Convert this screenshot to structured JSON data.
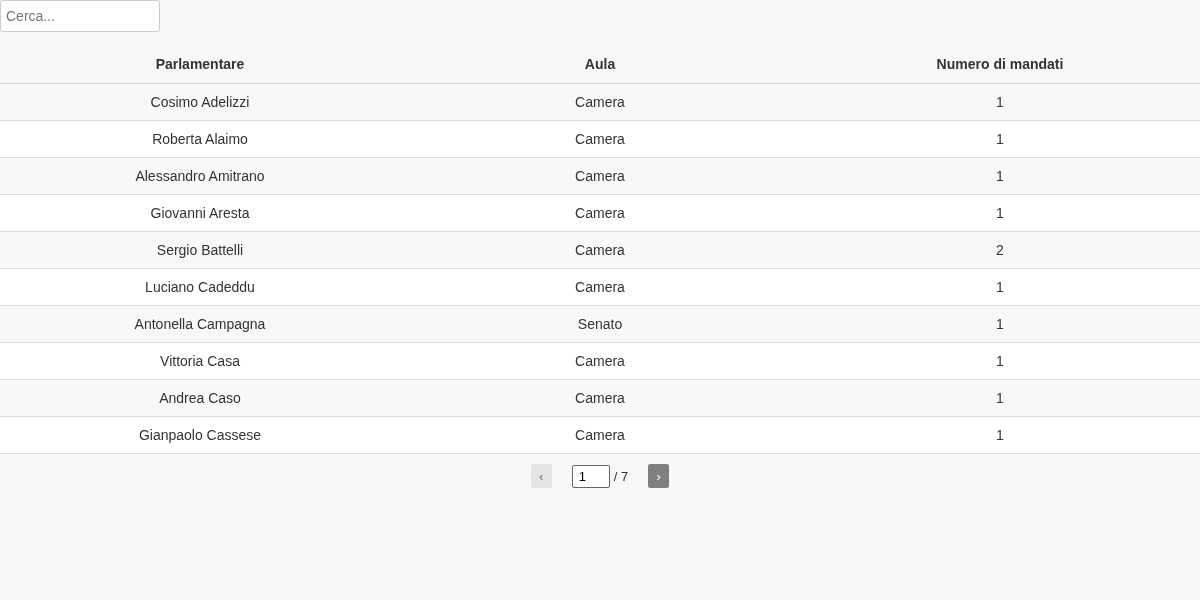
{
  "search": {
    "placeholder": "Cerca..."
  },
  "table": {
    "columns": [
      "Parlamentare",
      "Aula",
      "Numero di mandati"
    ],
    "rows": [
      [
        "Cosimo Adelizzi",
        "Camera",
        "1"
      ],
      [
        "Roberta Alaimo",
        "Camera",
        "1"
      ],
      [
        "Alessandro Amitrano",
        "Camera",
        "1"
      ],
      [
        "Giovanni Aresta",
        "Camera",
        "1"
      ],
      [
        "Sergio Battelli",
        "Camera",
        "2"
      ],
      [
        "Luciano Cadeddu",
        "Camera",
        "1"
      ],
      [
        "Antonella Campagna",
        "Senato",
        "1"
      ],
      [
        "Vittoria Casa",
        "Camera",
        "1"
      ],
      [
        "Andrea Caso",
        "Camera",
        "1"
      ],
      [
        "Gianpaolo Cassese",
        "Camera",
        "1"
      ]
    ]
  },
  "pagination": {
    "prev": {
      "label": "‹",
      "disabled": true
    },
    "page": "1",
    "total": "/ 7",
    "next": {
      "label": "›",
      "disabled": false
    }
  }
}
